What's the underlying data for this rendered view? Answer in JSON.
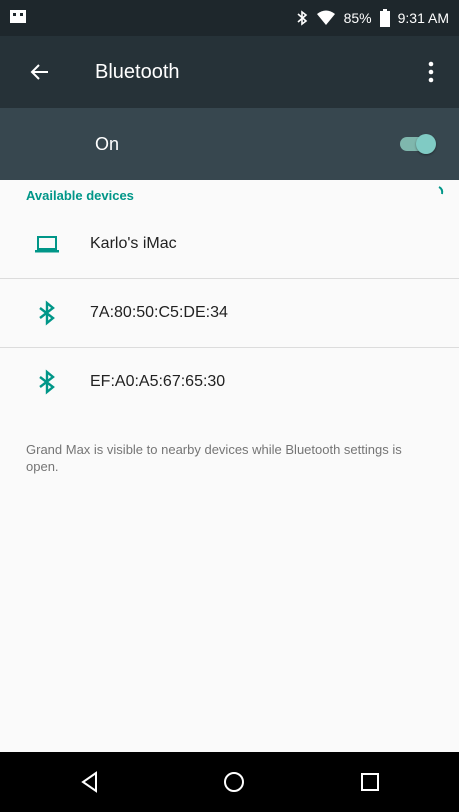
{
  "status_bar": {
    "battery_percent": "85%",
    "time": "9:31 AM"
  },
  "toolbar": {
    "title": "Bluetooth"
  },
  "switch_bar": {
    "label": "On",
    "enabled": true
  },
  "section": {
    "header": "Available devices"
  },
  "devices": [
    {
      "name": "Karlo's iMac",
      "icon": "laptop-icon"
    },
    {
      "name": "7A:80:50:C5:DE:34",
      "icon": "bluetooth-icon"
    },
    {
      "name": "EF:A0:A5:67:65:30",
      "icon": "bluetooth-icon"
    }
  ],
  "footer": {
    "text": "Grand Max is visible to nearby devices while Bluetooth settings is open."
  },
  "colors": {
    "accent": "#009688",
    "toolbar": "#263238",
    "switch_bar": "#37474f",
    "status_bar": "#1e272c"
  }
}
